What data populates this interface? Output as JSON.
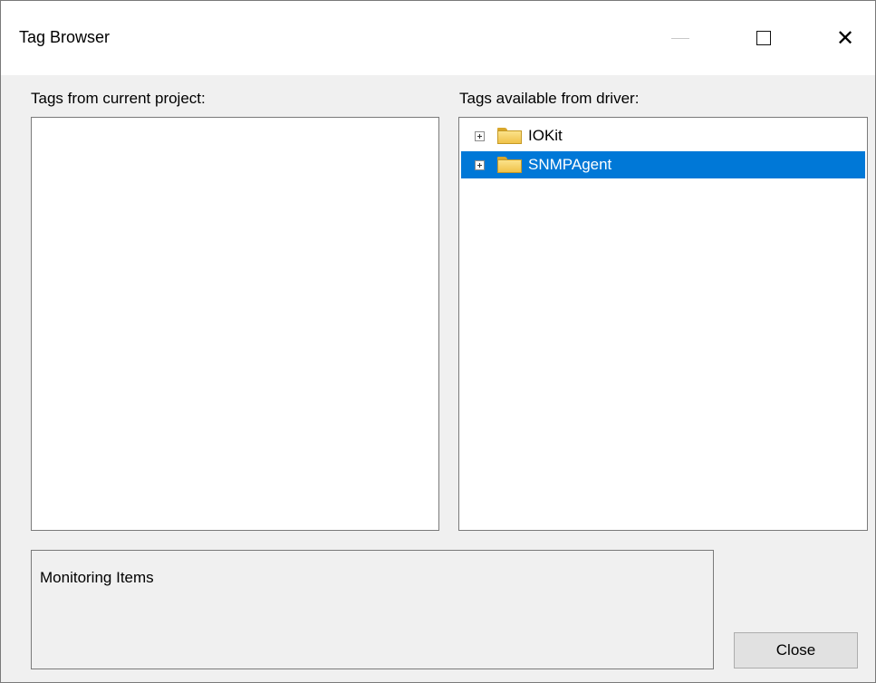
{
  "window": {
    "title": "Tag Browser",
    "close_glyph": "✕"
  },
  "left_panel": {
    "label": "Tags from current project:"
  },
  "right_panel": {
    "label": "Tags available from driver:",
    "tree": [
      {
        "label": "IOKit",
        "icon": "folder-icon",
        "expander": "plus",
        "selected": false
      },
      {
        "label": "SNMPAgent",
        "icon": "folder-icon",
        "expander": "plus",
        "selected": true
      }
    ]
  },
  "groupbox": {
    "label": "Monitoring Items"
  },
  "buttons": {
    "close_label": "Close"
  },
  "colors": {
    "selection": "#0078d7",
    "window_bg": "#f0f0f0"
  }
}
